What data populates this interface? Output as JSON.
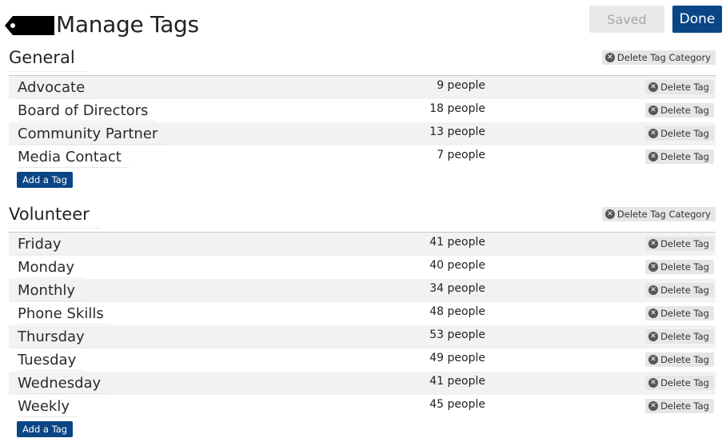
{
  "header": {
    "title": "Manage Tags",
    "saved_label": "Saved",
    "done_label": "Done"
  },
  "labels": {
    "delete_category": "Delete Tag Category",
    "delete_tag": "Delete Tag",
    "add_tag": "Add a Tag"
  },
  "colors": {
    "accent": "#0a4585",
    "row_stripe": "#f2f2f2",
    "button_gray": "#e6e6e6"
  },
  "categories": [
    {
      "name": "General",
      "tags": [
        {
          "name": "Advocate",
          "count": "9 people"
        },
        {
          "name": "Board of Directors",
          "count": "18 people"
        },
        {
          "name": "Community Partner",
          "count": "13 people"
        },
        {
          "name": "Media Contact",
          "count": "7 people"
        }
      ]
    },
    {
      "name": "Volunteer",
      "tags": [
        {
          "name": "Friday",
          "count": "41 people"
        },
        {
          "name": "Monday",
          "count": "40 people"
        },
        {
          "name": "Monthly",
          "count": "34 people"
        },
        {
          "name": "Phone Skills",
          "count": "48 people"
        },
        {
          "name": "Thursday",
          "count": "53 people"
        },
        {
          "name": "Tuesday",
          "count": "49 people"
        },
        {
          "name": "Wednesday",
          "count": "41 people"
        },
        {
          "name": "Weekly",
          "count": "45 people"
        }
      ]
    }
  ]
}
